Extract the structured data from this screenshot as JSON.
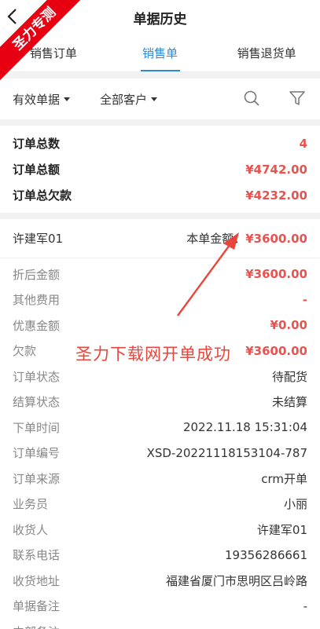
{
  "header": {
    "title": "单据历史",
    "back_icon": "chevron-left-icon"
  },
  "ribbon": {
    "text": "圣力专测"
  },
  "tabs": [
    {
      "label": "销售订单",
      "active": false
    },
    {
      "label": "销售单",
      "active": true
    },
    {
      "label": "销售退货单",
      "active": false
    }
  ],
  "filter": {
    "status_label": "有效单据",
    "customer_label": "全部客户",
    "search_icon": "search-icon",
    "filter_icon": "filter-icon"
  },
  "summary": {
    "count_label": "订单总数",
    "count_value": "4",
    "total_label": "订单总额",
    "total_value": "¥4742.00",
    "debt_label": "订单总欠款",
    "debt_value": "¥4232.00"
  },
  "order": {
    "customer": "许建军01",
    "amount_label": "本单金额：",
    "amount_value": "¥3600.00",
    "rows": [
      {
        "label": "折后金额",
        "value": "¥3600.00",
        "red": true
      },
      {
        "label": "其他费用",
        "value": "-",
        "red": true
      },
      {
        "label": "优惠金额",
        "value": "¥0.00",
        "red": true
      },
      {
        "label": "欠款",
        "value": "¥3600.00",
        "red": true
      },
      {
        "label": "订单状态",
        "value": "待配货",
        "red": false
      },
      {
        "label": "结算状态",
        "value": "未结算",
        "red": false
      },
      {
        "label": "下单时间",
        "value": "2022.11.18 15:31:04",
        "red": false
      },
      {
        "label": "订单编号",
        "value": "XSD-20221118153104-787",
        "red": false
      },
      {
        "label": "订单来源",
        "value": "crm开单",
        "red": false
      },
      {
        "label": "业务员",
        "value": "小丽",
        "red": false
      },
      {
        "label": "收货人",
        "value": "许建军01",
        "red": false
      },
      {
        "label": "联系电话",
        "value": "19356286661",
        "red": false
      },
      {
        "label": "收货地址",
        "value": "福建省厦门市思明区吕岭路",
        "red": false
      },
      {
        "label": "单据备注",
        "value": "-",
        "red": false
      },
      {
        "label": "内部备注",
        "value": "-",
        "red": false
      }
    ]
  },
  "annotation": {
    "text": "圣力下载网开单成功",
    "color": "#e9453a"
  }
}
